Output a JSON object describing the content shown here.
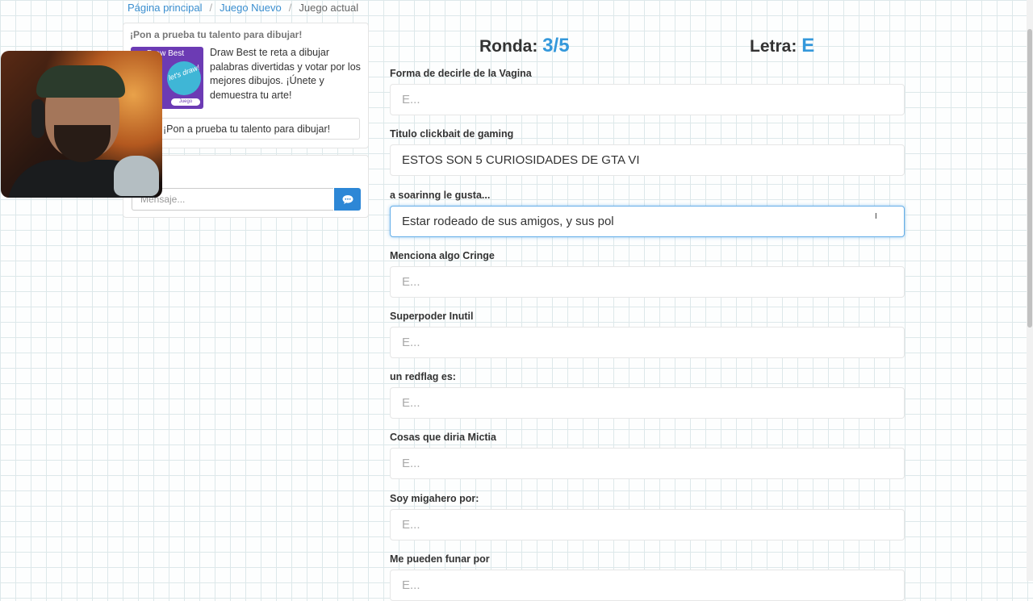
{
  "breadcrumb": {
    "home": "Página principal",
    "new_game": "Juego Nuevo",
    "current": "Juego actual",
    "separator": "/"
  },
  "promo": {
    "heading": "¡Pon a prueba tu talento para dibujar!",
    "thumb_title": "Draw Best",
    "thumb_blob": "let's draw!",
    "thumb_badge": "Juego",
    "description": "Draw Best te reta a dibujar palabras divertidas y votar por los mejores dibujos. ¡Únete y demuestra tu arte!",
    "button": "¡Pon a prueba tu talento para dibujar!"
  },
  "chat": {
    "placeholder": "Mensaje...",
    "send_icon": "speech-bubble-icon"
  },
  "game": {
    "round_label": "Ronda:",
    "round_value": "3/5",
    "letter_label": "Letra:",
    "letter_value": "E",
    "accent_color": "#3498db"
  },
  "fields": [
    {
      "label": "Forma de decirle de la Vagina",
      "value": "",
      "placeholder": "E..."
    },
    {
      "label": "Titulo clickbait de gaming",
      "value": "ESTOS SON 5 CURIOSIDADES DE GTA VI",
      "placeholder": "E..."
    },
    {
      "label": "a soarinng le gusta...",
      "value": "Estar rodeado de sus amigos, y sus pol",
      "placeholder": "E..."
    },
    {
      "label": "Menciona algo Cringe",
      "value": "",
      "placeholder": "E..."
    },
    {
      "label": "Superpoder Inutil",
      "value": "",
      "placeholder": "E..."
    },
    {
      "label": "un redflag es:",
      "value": "",
      "placeholder": "E..."
    },
    {
      "label": "Cosas que diria Mictia",
      "value": "",
      "placeholder": "E..."
    },
    {
      "label": "Soy migahero por:",
      "value": "",
      "placeholder": "E..."
    },
    {
      "label": "Me pueden funar por",
      "value": "",
      "placeholder": "E..."
    }
  ]
}
